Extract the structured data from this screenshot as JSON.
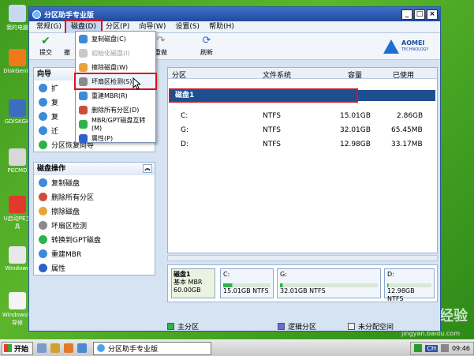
{
  "desktop": {
    "icons": [
      {
        "label": "我的电脑"
      },
      {
        "label": "DiskGeniu"
      },
      {
        "label": "GDISKGH"
      },
      {
        "label": "PECMD"
      },
      {
        "label": "U启动PE工具"
      },
      {
        "label": "Windows"
      },
      {
        "label": "Windows引导修"
      }
    ],
    "watermark": "Bai 经验",
    "watermark_url": "jingyan.baidu.com"
  },
  "window": {
    "title": "分区助手专业版"
  },
  "menubar": {
    "items": [
      "常规(G)",
      "磁盘(D)",
      "分区(P)",
      "向导(W)",
      "设置(S)",
      "帮助(H)"
    ]
  },
  "toolbar": {
    "commit": "提交",
    "undo": "撤",
    "redo": "重做",
    "refresh": "刷新",
    "brand": "AOMEI",
    "brand_sub": "TECHNOLOGY"
  },
  "disk_menu": {
    "items": [
      {
        "label": "复制磁盘(C)",
        "disabled": false
      },
      {
        "label": "初始化磁盘(I)",
        "disabled": true
      },
      {
        "label": "擦除磁盘(W)",
        "disabled": false
      },
      {
        "label": "坏扇区检测(S)",
        "disabled": false
      },
      {
        "label": "重建MBR(R)",
        "disabled": false
      },
      {
        "label": "删除所有分区(D)",
        "disabled": false
      },
      {
        "label": "MBR/GPT磁盘互转(M)",
        "disabled": false
      },
      {
        "label": "属性(P)",
        "disabled": false
      }
    ]
  },
  "wizard_panel": {
    "title": "向导",
    "items": [
      "扩",
      "复",
      "复",
      "迁",
      "分区恢复向导"
    ]
  },
  "disk_ops_panel": {
    "title": "磁盘操作",
    "items": [
      "复制磁盘",
      "删除所有分区",
      "擦除磁盘",
      "坏扇区检测",
      "转换到GPT磁盘",
      "重建MBR",
      "属性"
    ]
  },
  "grid": {
    "headers": [
      "分区",
      "文件系统",
      "容量",
      "已使用"
    ],
    "disk_label": "磁盘1",
    "rows": [
      {
        "partition": "C:",
        "fs": "NTFS",
        "capacity": "15.01GB",
        "used": "2.86GB"
      },
      {
        "partition": "G:",
        "fs": "NTFS",
        "capacity": "32.01GB",
        "used": "65.45MB"
      },
      {
        "partition": "D:",
        "fs": "NTFS",
        "capacity": "12.98GB",
        "used": "33.17MB"
      }
    ]
  },
  "diskmap": {
    "disk": {
      "name": "磁盘1",
      "type": "基本 MBR",
      "size": "60.00GB"
    },
    "parts": [
      {
        "letter": "C:",
        "desc": "15.01GB NTFS",
        "used_fraction": 0.19
      },
      {
        "letter": "G:",
        "desc": "32.01GB NTFS",
        "used_fraction": 0.02
      },
      {
        "letter": "D:",
        "desc": "12.98GB NTFS",
        "used_fraction": 0.02
      }
    ]
  },
  "legend": {
    "primary": "主分区",
    "logical": "逻辑分区",
    "unallocated": "未分配空间"
  },
  "taskbar": {
    "start": "开始",
    "task": "分区助手专业版",
    "lang": "CH",
    "time": "09:46"
  },
  "colors": {
    "primary": "#2db34a",
    "logical": "#6a6ad8",
    "highlight": "#e0101a"
  }
}
